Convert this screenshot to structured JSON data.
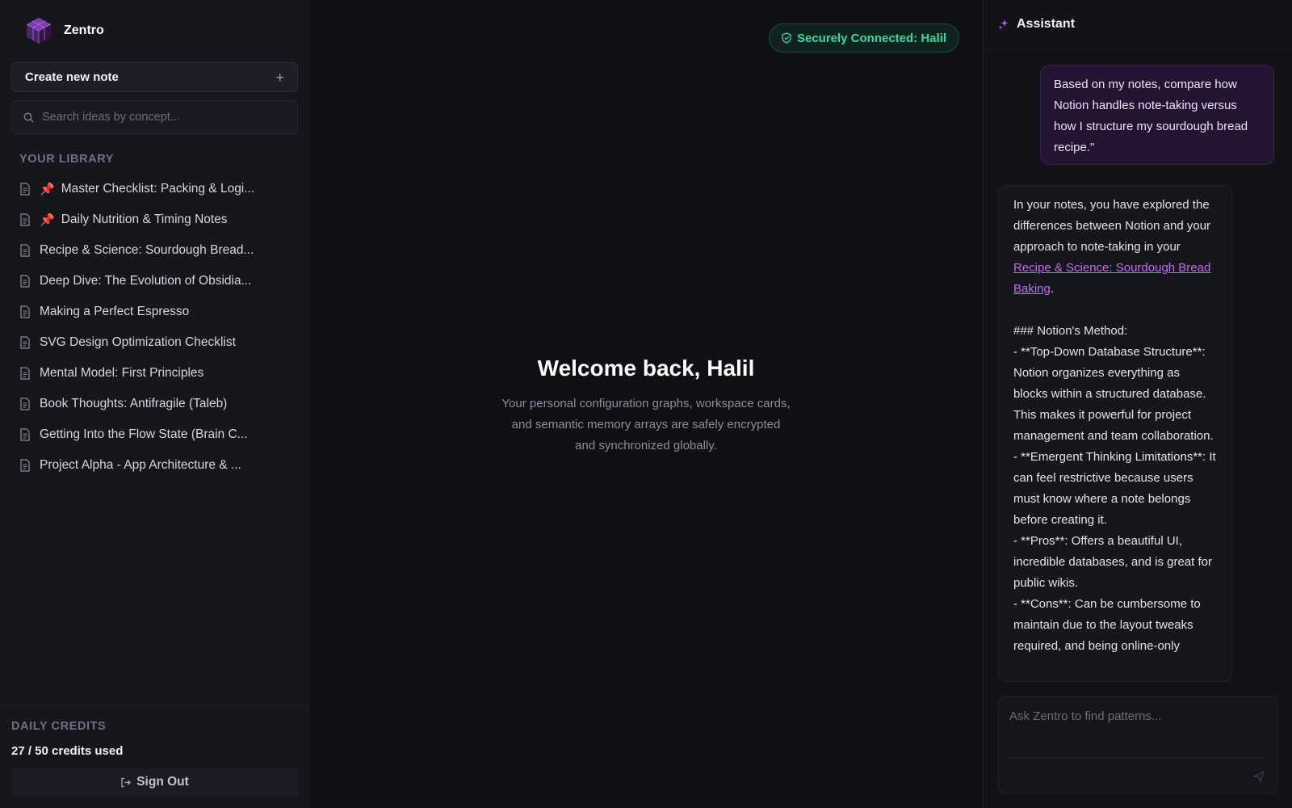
{
  "app": {
    "name": "Zentro"
  },
  "sidebar": {
    "create_label": "Create new note",
    "create_icon": "+",
    "search_placeholder": "Search ideas by concept...",
    "library_title": "YOUR LIBRARY",
    "notes": [
      {
        "title": "Master Checklist: Packing & Logi...",
        "pinned": true
      },
      {
        "title": "Daily Nutrition & Timing Notes",
        "pinned": true
      },
      {
        "title": "Recipe & Science: Sourdough Bread...",
        "pinned": false
      },
      {
        "title": "Deep Dive: The Evolution of Obsidia...",
        "pinned": false
      },
      {
        "title": "Making a Perfect Espresso",
        "pinned": false
      },
      {
        "title": "SVG Design Optimization Checklist",
        "pinned": false
      },
      {
        "title": "Mental Model: First Principles",
        "pinned": false
      },
      {
        "title": "Book Thoughts: Antifragile (Taleb)",
        "pinned": false
      },
      {
        "title": "Getting Into the Flow State (Brain C...",
        "pinned": false
      },
      {
        "title": "Project Alpha - App Architecture & ...",
        "pinned": false
      }
    ],
    "credits_title": "DAILY CREDITS",
    "credits_used": "27 / 50 credits used",
    "signout_label": "Sign Out"
  },
  "main": {
    "connection_status": "Securely Connected: Halil",
    "welcome_title": "Welcome back, Halil",
    "welcome_sub": "Your personal configuration graphs, workspace cards, and semantic memory arrays are safely encrypted and synchronized globally."
  },
  "assistant": {
    "title": "Assistant",
    "user_message": "Based on my notes, compare how Notion handles note-taking versus how I structure my sourdough bread recipe.\"",
    "bot_intro": "In your notes, you have explored the differences between Notion and your approach to note-taking in your ",
    "bot_link": "Recipe & Science: Sourdough Bread Baking",
    "bot_after_link": ".",
    "bot_body": "\n\n### Notion's Method:\n- **Top-Down Database Structure**: Notion organizes everything as blocks within a structured database. This makes it powerful for project management and team collaboration.\n- **Emergent Thinking Limitations**: It can feel restrictive because users must know where a note belongs before creating it.\n- **Pros**: Offers a beautiful UI, incredible databases, and is great for public wikis.\n- **Cons**: Can be cumbersome to maintain due to the layout tweaks required, and being online-only",
    "input_placeholder": "Ask Zentro to find patterns..."
  },
  "colors": {
    "background": "#0f0f14",
    "sidebar": "#16161d",
    "accent": "#c36cf0",
    "pin": "#e8455e",
    "status_green": "#3fd69a",
    "user_bubble": "#241432"
  },
  "icons": {
    "logo": "cube-logo-icon",
    "search": "search-icon",
    "document": "document-icon",
    "pin": "pushpin-icon",
    "shield": "shield-check-icon",
    "sparkle": "sparkle-icon",
    "signout": "sign-out-icon",
    "send": "send-icon"
  }
}
